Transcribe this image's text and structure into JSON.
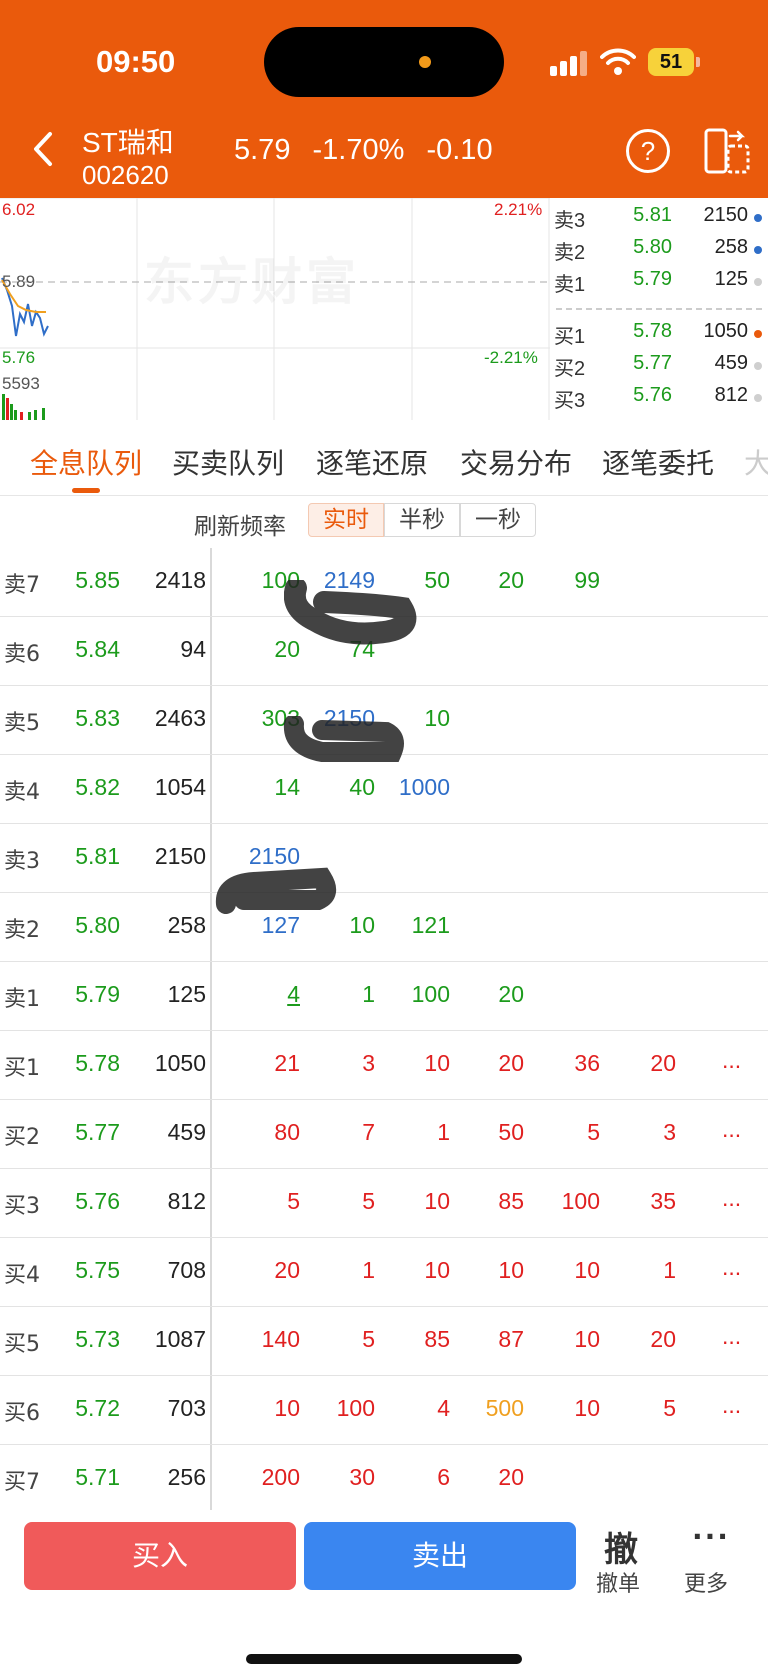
{
  "status": {
    "time": "09:50",
    "battery": "51"
  },
  "stock": {
    "name": "ST瑞和",
    "code": "002620",
    "price": "5.79",
    "pct": "-1.70%",
    "change": "-0.10"
  },
  "chart": {
    "high": "6.02",
    "high_pct": "2.21%",
    "mid": "5.89",
    "low": "5.76",
    "low_pct": "-2.21%",
    "volume": "5593",
    "watermark": "东方财富"
  },
  "orderbook": {
    "asks": [
      {
        "label": "卖3",
        "price": "5.81",
        "vol": "2150",
        "dot": "#2f6ec8"
      },
      {
        "label": "卖2",
        "price": "5.80",
        "vol": "258",
        "dot": "#2f6ec8"
      },
      {
        "label": "卖1",
        "price": "5.79",
        "vol": "125",
        "dot": "#cfcfcf"
      }
    ],
    "bids": [
      {
        "label": "买1",
        "price": "5.78",
        "vol": "1050",
        "dot": "#ea5a0c"
      },
      {
        "label": "买2",
        "price": "5.77",
        "vol": "459",
        "dot": "#cfcfcf"
      },
      {
        "label": "买3",
        "price": "5.76",
        "vol": "812",
        "dot": "#cfcfcf"
      }
    ]
  },
  "tabs": [
    "全息队列",
    "买卖队列",
    "逐笔还原",
    "交易分布",
    "逐笔委托",
    "大"
  ],
  "refresh": {
    "label": "刷新频率",
    "options": [
      "实时",
      "半秒",
      "一秒"
    ]
  },
  "queue": [
    {
      "side": "卖7",
      "price": "5.85",
      "vol": "2418",
      "cells": [
        [
          "100",
          "green"
        ],
        [
          "2149",
          "blue"
        ],
        [
          "50",
          "green"
        ],
        [
          "20",
          "green"
        ],
        [
          "99",
          "green"
        ]
      ]
    },
    {
      "side": "卖6",
      "price": "5.84",
      "vol": "94",
      "cells": [
        [
          "20",
          "green"
        ],
        [
          "74",
          "green"
        ]
      ]
    },
    {
      "side": "卖5",
      "price": "5.83",
      "vol": "2463",
      "cells": [
        [
          "303",
          "green"
        ],
        [
          "2150",
          "blue"
        ],
        [
          "10",
          "green"
        ]
      ]
    },
    {
      "side": "卖4",
      "price": "5.82",
      "vol": "1054",
      "cells": [
        [
          "14",
          "green"
        ],
        [
          "40",
          "green"
        ],
        [
          "1000",
          "blue"
        ]
      ]
    },
    {
      "side": "卖3",
      "price": "5.81",
      "vol": "2150",
      "cells": [
        [
          "2150",
          "blue"
        ]
      ]
    },
    {
      "side": "卖2",
      "price": "5.80",
      "vol": "258",
      "cells": [
        [
          "127",
          "blue"
        ],
        [
          "10",
          "green"
        ],
        [
          "121",
          "green"
        ]
      ]
    },
    {
      "side": "卖1",
      "price": "5.79",
      "vol": "125",
      "cells": [
        [
          "4",
          "green-u"
        ],
        [
          "1",
          "green"
        ],
        [
          "100",
          "green"
        ],
        [
          "20",
          "green"
        ]
      ]
    },
    {
      "side": "买1",
      "price": "5.78",
      "vol": "1050",
      "cells": [
        [
          "21",
          "red"
        ],
        [
          "3",
          "red"
        ],
        [
          "10",
          "red"
        ],
        [
          "20",
          "red"
        ],
        [
          "36",
          "red"
        ],
        [
          "20",
          "red"
        ]
      ],
      "more": "..."
    },
    {
      "side": "买2",
      "price": "5.77",
      "vol": "459",
      "cells": [
        [
          "80",
          "red"
        ],
        [
          "7",
          "red"
        ],
        [
          "1",
          "red"
        ],
        [
          "50",
          "red"
        ],
        [
          "5",
          "red"
        ],
        [
          "3",
          "red"
        ]
      ],
      "more": "..."
    },
    {
      "side": "买3",
      "price": "5.76",
      "vol": "812",
      "cells": [
        [
          "5",
          "red"
        ],
        [
          "5",
          "red"
        ],
        [
          "10",
          "red"
        ],
        [
          "85",
          "red"
        ],
        [
          "100",
          "red"
        ],
        [
          "35",
          "red"
        ]
      ],
      "more": "..."
    },
    {
      "side": "买4",
      "price": "5.75",
      "vol": "708",
      "cells": [
        [
          "20",
          "red"
        ],
        [
          "1",
          "red"
        ],
        [
          "10",
          "red"
        ],
        [
          "10",
          "red"
        ],
        [
          "10",
          "red"
        ],
        [
          "1",
          "red"
        ]
      ],
      "more": "..."
    },
    {
      "side": "买5",
      "price": "5.73",
      "vol": "1087",
      "cells": [
        [
          "140",
          "red"
        ],
        [
          "5",
          "red"
        ],
        [
          "85",
          "red"
        ],
        [
          "87",
          "red"
        ],
        [
          "10",
          "red"
        ],
        [
          "20",
          "red"
        ]
      ],
      "more": "..."
    },
    {
      "side": "买6",
      "price": "5.72",
      "vol": "703",
      "cells": [
        [
          "10",
          "red"
        ],
        [
          "100",
          "red"
        ],
        [
          "4",
          "red"
        ],
        [
          "500",
          "orange"
        ],
        [
          "10",
          "red"
        ],
        [
          "5",
          "red"
        ]
      ],
      "more": "..."
    },
    {
      "side": "买7",
      "price": "5.71",
      "vol": "256",
      "cells": [
        [
          "200",
          "red"
        ],
        [
          "30",
          "red"
        ],
        [
          "6",
          "red"
        ],
        [
          "20",
          "red"
        ]
      ]
    }
  ],
  "actions": {
    "buy": "买入",
    "sell": "卖出",
    "cancel_glyph": "撤",
    "cancel": "撤单",
    "more_glyph": "···",
    "more": "更多"
  },
  "colors": {
    "brand": "#ea5a0c",
    "up": "#e02020",
    "down": "#1c9b1c",
    "blue": "#2f6ec8"
  },
  "icons": [
    "back-icon",
    "help-icon",
    "switch-icon",
    "signal-icon",
    "wifi-icon",
    "battery-icon"
  ]
}
